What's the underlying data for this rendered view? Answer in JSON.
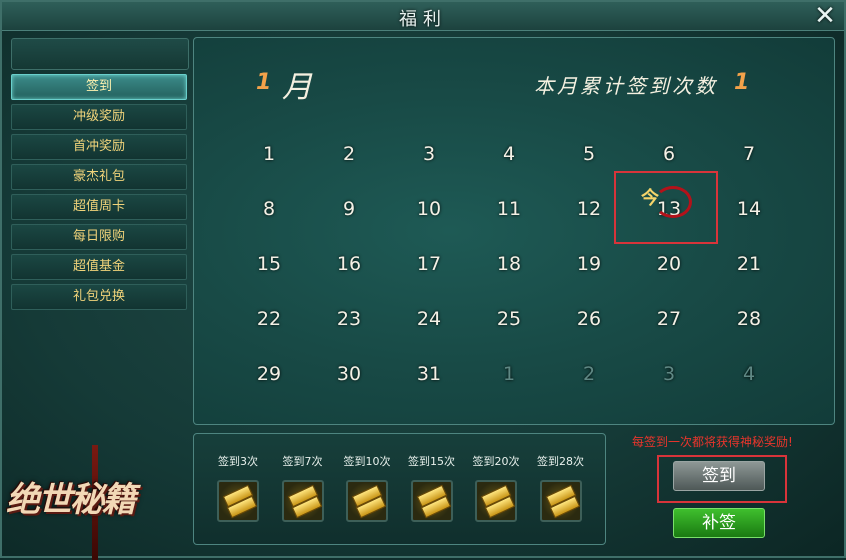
{
  "window": {
    "title": "福利",
    "close_glyph": "✕"
  },
  "sidebar": {
    "items": [
      {
        "label": "签到",
        "active": true
      },
      {
        "label": "冲级奖励"
      },
      {
        "label": "首冲奖励"
      },
      {
        "label": "豪杰礼包"
      },
      {
        "label": "超值周卡"
      },
      {
        "label": "每日限购"
      },
      {
        "label": "超值基金"
      },
      {
        "label": "礼包兑换"
      }
    ]
  },
  "logo_text": "绝世秘籍",
  "calendar": {
    "month_number": "1",
    "month_unit": "月",
    "count_label": "本月累计签到次数",
    "count_value": "1",
    "today_mark": "今",
    "days": [
      {
        "d": "1"
      },
      {
        "d": "2"
      },
      {
        "d": "3"
      },
      {
        "d": "4"
      },
      {
        "d": "5"
      },
      {
        "d": "6"
      },
      {
        "d": "7"
      },
      {
        "d": "8"
      },
      {
        "d": "9"
      },
      {
        "d": "10"
      },
      {
        "d": "11"
      },
      {
        "d": "12"
      },
      {
        "d": "13",
        "today": true
      },
      {
        "d": "14"
      },
      {
        "d": "15"
      },
      {
        "d": "16"
      },
      {
        "d": "17"
      },
      {
        "d": "18"
      },
      {
        "d": "19"
      },
      {
        "d": "20"
      },
      {
        "d": "21"
      },
      {
        "d": "22"
      },
      {
        "d": "23"
      },
      {
        "d": "24"
      },
      {
        "d": "25"
      },
      {
        "d": "26"
      },
      {
        "d": "27"
      },
      {
        "d": "28"
      },
      {
        "d": "29"
      },
      {
        "d": "30"
      },
      {
        "d": "31"
      },
      {
        "d": "1",
        "dim": true
      },
      {
        "d": "2",
        "dim": true
      },
      {
        "d": "3",
        "dim": true
      },
      {
        "d": "4",
        "dim": true
      }
    ]
  },
  "rewards": [
    {
      "label": "签到3次",
      "icon": "gold-bar-icon"
    },
    {
      "label": "签到7次",
      "icon": "gold-bar-icon"
    },
    {
      "label": "签到10次",
      "icon": "gold-bar-icon"
    },
    {
      "label": "签到15次",
      "icon": "gold-bar-icon"
    },
    {
      "label": "签到20次",
      "icon": "gold-bar-icon"
    },
    {
      "label": "签到28次",
      "icon": "gold-bar-icon"
    }
  ],
  "hint": "每签到一次都将获得神秘奖励!",
  "buttons": {
    "sign_in": "签到",
    "resign": "补签"
  },
  "colors": {
    "accent_red": "#d8343a",
    "gold": "#f0d37a",
    "green_button": "#3fbf2e"
  }
}
